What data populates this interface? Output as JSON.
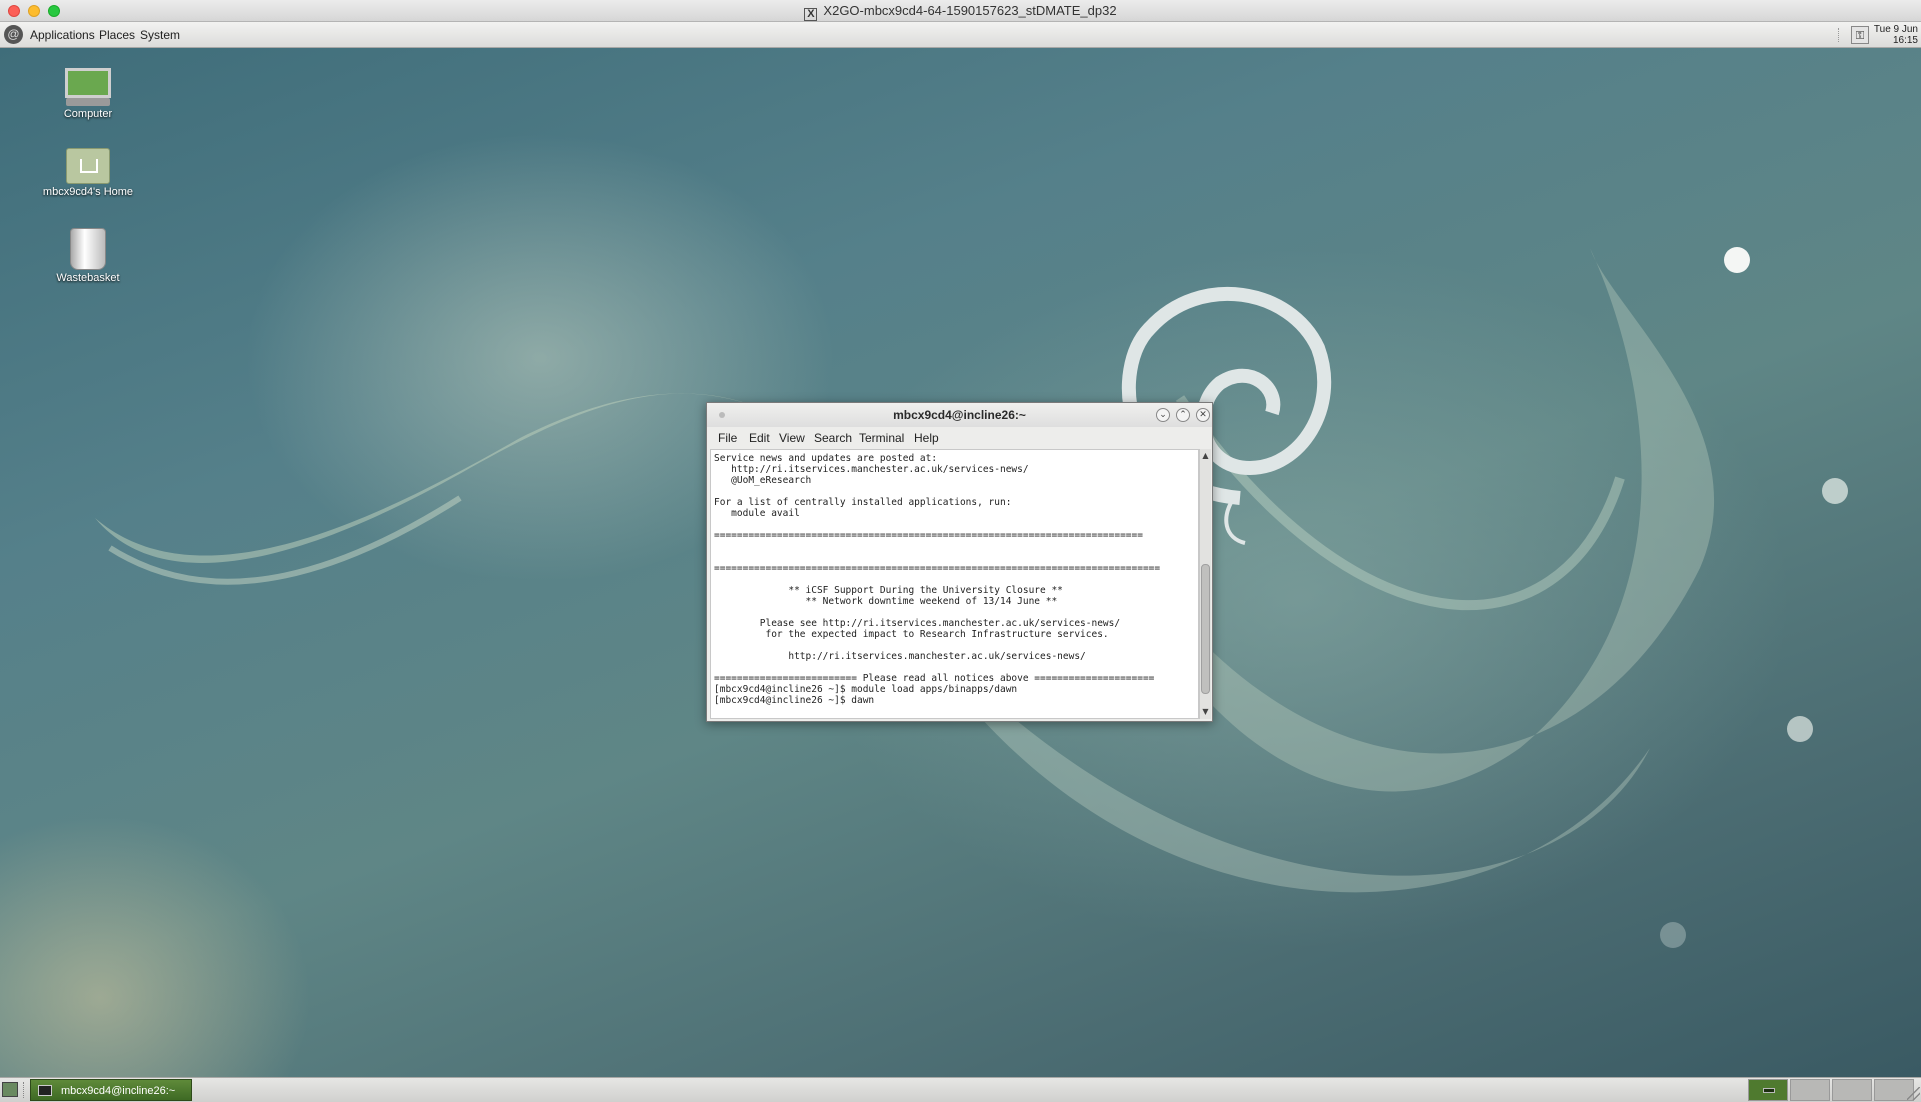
{
  "outer_window": {
    "title": "X2GO-mbcx9cd4-64-1590157623_stDMATE_dp32",
    "x_icon_glyph": "X"
  },
  "top_panel": {
    "menus": [
      "Applications",
      "Places",
      "System"
    ],
    "clock": {
      "line1": "Tue 9 Jun",
      "line2": "16:15"
    }
  },
  "desktop_icons": [
    {
      "label": "Computer",
      "icon": "computer-icon"
    },
    {
      "label": "mbcx9cd4's Home",
      "icon": "home-folder-icon"
    },
    {
      "label": "Wastebasket",
      "icon": "trash-icon"
    }
  ],
  "terminal": {
    "title": "mbcx9cd4@incline26:~",
    "menus": [
      "File",
      "Edit",
      "View",
      "Search",
      "Terminal",
      "Help"
    ],
    "lines": [
      "Service news and updates are posted at:",
      "   http://ri.itservices.manchester.ac.uk/services-news/",
      "   @UoM_eResearch",
      "",
      "For a list of centrally installed applications, run:",
      "   module avail",
      "",
      "===========================================================================",
      "",
      "",
      "==============================================================================",
      "",
      "             ** iCSF Support During the University Closure **",
      "                ** Network downtime weekend of 13/14 June **",
      "",
      "        Please see http://ri.itservices.manchester.ac.uk/services-news/",
      "         for the expected impact to Research Infrastructure services.",
      "",
      "             http://ri.itservices.manchester.ac.uk/services-news/",
      "",
      "========================= Please read all notices above =====================",
      "[mbcx9cd4@incline26 ~]$ module load apps/binapps/dawn",
      "[mbcx9cd4@incline26 ~]$ dawn"
    ]
  },
  "bottom_panel": {
    "task_label": "mbcx9cd4@incline26:~",
    "workspaces": 4
  },
  "colors": {
    "task_active": "#4f7a2f",
    "desktop_base": "#4b6c72"
  }
}
